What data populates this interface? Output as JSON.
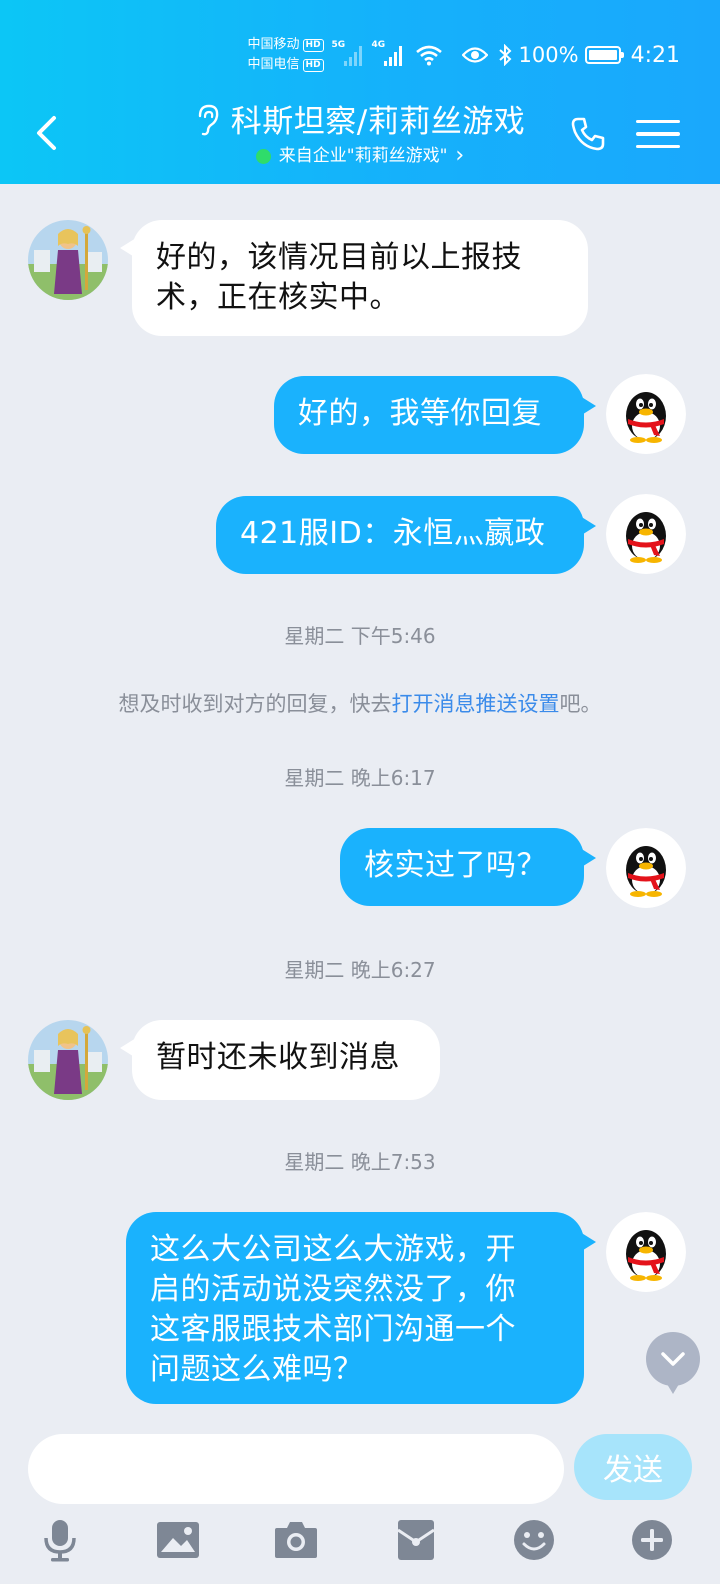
{
  "status_bar": {
    "carrier1": "中国移动",
    "carrier2": "中国电信",
    "hd_badge": "HD",
    "network1": "5G",
    "network2": "4G",
    "battery": "100%",
    "time": "4:21"
  },
  "header": {
    "title": "科斯坦察/莉莉丝游戏",
    "subtitle": "来自企业\"莉莉丝游戏\"",
    "subtitle_chevron": "›"
  },
  "messages": [
    {
      "side": "in",
      "text_lines": [
        "好的，该情况目前以上报技",
        "术，正在核实中。"
      ]
    },
    {
      "side": "out",
      "text_lines": [
        "好的，我等你回复"
      ]
    },
    {
      "side": "out",
      "text_lines": [
        "421服ID：永恒灬嬴政"
      ]
    },
    {
      "type": "time",
      "text": "星期二 下午5:46"
    },
    {
      "type": "notice",
      "before": "想及时收到对方的回复，快去",
      "link": "打开消息推送设置",
      "after": "吧。"
    },
    {
      "type": "time",
      "text": "星期二 晚上6:17"
    },
    {
      "side": "out",
      "text_lines": [
        "核实过了吗？"
      ]
    },
    {
      "type": "time",
      "text": "星期二 晚上6:27"
    },
    {
      "side": "in",
      "text_lines": [
        "暂时还未收到消息"
      ]
    },
    {
      "type": "time",
      "text": "星期二 晚上7:53"
    },
    {
      "side": "out",
      "text_lines": [
        "这么大公司这么大游戏，开",
        "启的活动说没突然没了，你",
        "这客服跟技术部门沟通一个",
        "问题这么难吗？"
      ]
    }
  ],
  "input": {
    "placeholder": "",
    "send_label": "发送"
  },
  "toolbar": [
    "microphone-icon",
    "image-icon",
    "camera-icon",
    "red-packet-icon",
    "emoji-icon",
    "plus-icon"
  ],
  "colors": {
    "header_start": "#0cc6f6",
    "header_end": "#1aa8fc",
    "outgoing_bubble": "#1ab2fd",
    "incoming_bubble": "#ffffff",
    "chat_background": "#eaedf3",
    "link": "#3b8bea",
    "send_button": "#a7e4fb"
  }
}
